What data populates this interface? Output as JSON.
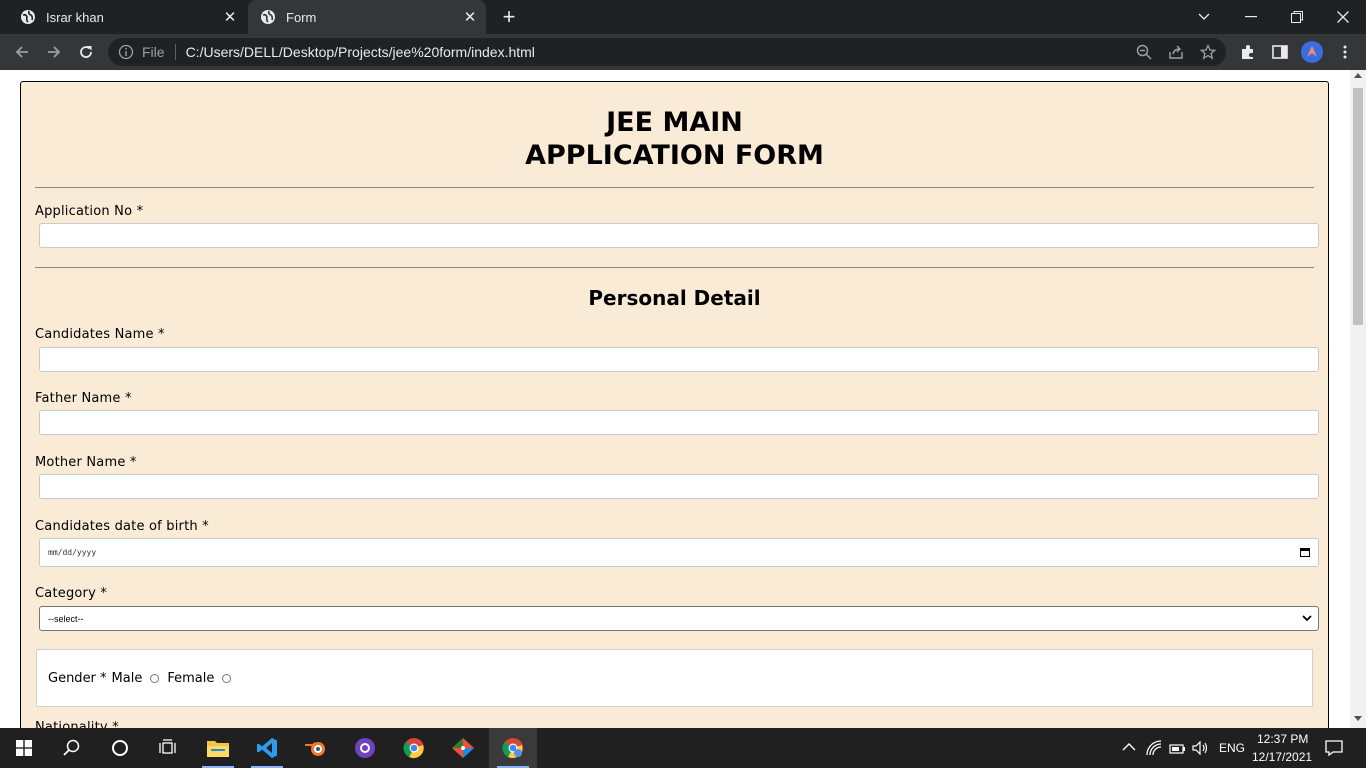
{
  "browser": {
    "tabs": [
      {
        "title": "Israr khan",
        "active": false
      },
      {
        "title": "Form",
        "active": true
      }
    ],
    "new_tab_symbol": "+",
    "address": {
      "scheme_label": "File",
      "url": "C:/Users/DELL/Desktop/Projects/jee%20form/index.html"
    }
  },
  "form": {
    "title_line1": "JEE MAIN",
    "title_line2": "APPLICATION FORM",
    "application_no_label": "Application No *",
    "section_title": "Personal Detail",
    "candidate_name_label": "Candidates Name *",
    "father_name_label": "Father Name *",
    "mother_name_label": "Mother Name *",
    "dob_label": "Candidates date of birth *",
    "dob_placeholder": "mm/dd/yyyy",
    "category_label": "Category *",
    "category_selected": "--select--",
    "gender_label": "Gender *",
    "gender_options": [
      "Male",
      "Female"
    ],
    "nationality_label": "Nationality *"
  },
  "taskbar": {
    "apps": [
      "file-explorer",
      "vs-code",
      "blender",
      "github-desktop",
      "chrome",
      "git",
      "chrome-active"
    ],
    "tray": {
      "language": "ENG",
      "time": "12:37 PM",
      "date": "12/17/2021"
    }
  },
  "colors": {
    "form_background": "#faebd7",
    "chrome_dark": "#202124",
    "chrome_toolbar": "#35363a",
    "taskbar": "#202020"
  }
}
